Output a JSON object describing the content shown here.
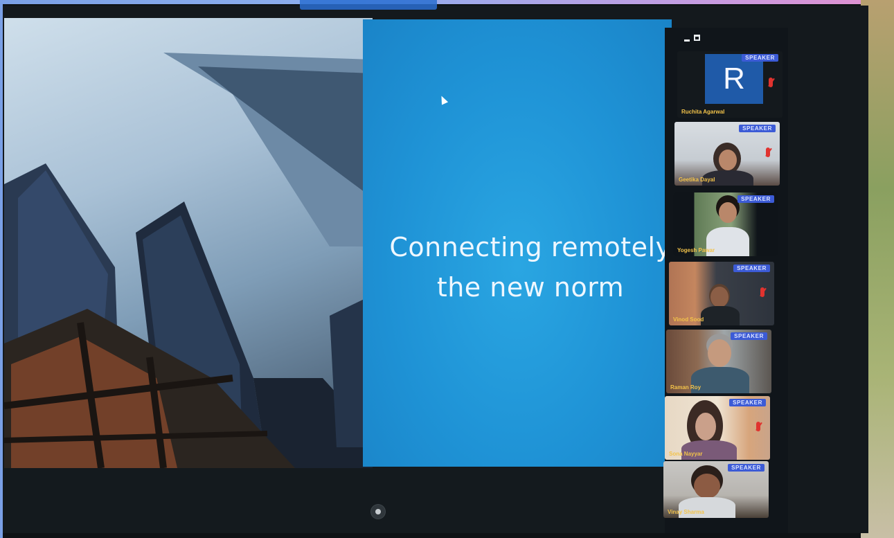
{
  "meeting": {
    "top_label": "",
    "slide_title": "Connecting remotely\nthe new norm"
  },
  "participants": [
    {
      "name": "Ruchita Agarwal",
      "role": "SPEAKER",
      "avatar_letter": "R",
      "muted": true,
      "video": false
    },
    {
      "name": "Geetika Dayal",
      "role": "SPEAKER",
      "muted": true,
      "video": true
    },
    {
      "name": "Yogesh Pawar",
      "role": "SPEAKER",
      "muted": false,
      "video": true
    },
    {
      "name": "Vinod Sood",
      "role": "SPEAKER",
      "muted": true,
      "video": true
    },
    {
      "name": "Raman Roy",
      "role": "SPEAKER",
      "muted": false,
      "video": true
    },
    {
      "name": "Sona Nayyar",
      "role": "SPEAKER",
      "muted": true,
      "video": true
    },
    {
      "name": "Vinay Sharma",
      "role": "SPEAKER",
      "muted": false,
      "video": true
    }
  ],
  "colors": {
    "slide_blue": "#1f93d6",
    "badge": "#3c5bd6",
    "name_text": "#f3c34a",
    "muted_icon": "#e0332f"
  }
}
